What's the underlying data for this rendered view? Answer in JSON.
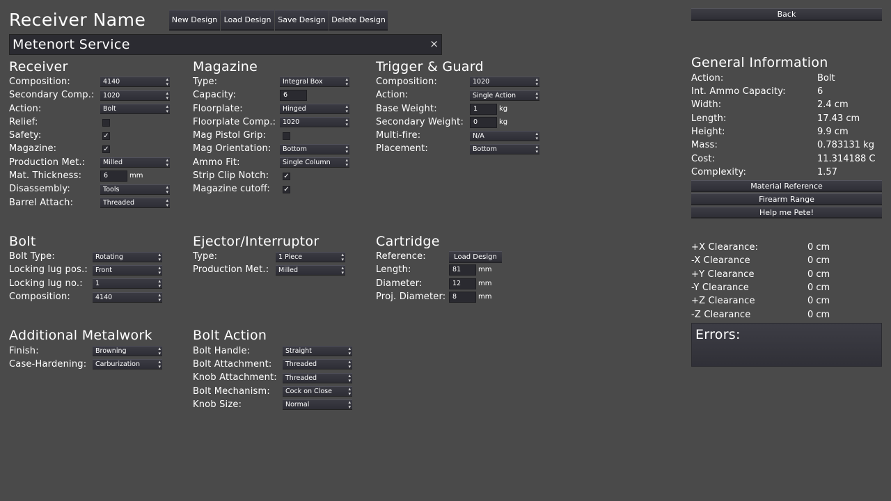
{
  "header": {
    "title": "Receiver Name",
    "buttons": [
      "New Design",
      "Load Design",
      "Save Design",
      "Delete Design"
    ],
    "name_value": "Metenort Service",
    "clear_glyph": "×",
    "back": "Back"
  },
  "receiver": {
    "heading": "Receiver",
    "labels": [
      "Composition:",
      "Secondary Comp.:",
      "Action:",
      "Relief:",
      "Safety:",
      "Magazine:",
      "Production Met.:",
      "Mat. Thickness:",
      "Disassembly:",
      "Barrel Attach:"
    ],
    "composition": "4140",
    "secondary": "1020",
    "action": "Bolt",
    "relief": false,
    "safety": true,
    "magazine": true,
    "production": "Milled",
    "thickness": "6",
    "thickness_unit": "mm",
    "disassembly": "Tools",
    "barrel_attach": "Threaded"
  },
  "magazine": {
    "heading": "Magazine",
    "labels": [
      "Type:",
      "Capacity:",
      "Floorplate:",
      "Floorplate Comp.:",
      "Mag Pistol Grip:",
      "Mag Orientation:",
      "Ammo Fit:",
      "Strip Clip Notch:",
      "Magazine cutoff:"
    ],
    "type": "Integral Box",
    "capacity": "6",
    "floorplate": "Hinged",
    "floorplate_comp": "1020",
    "pistol_grip": false,
    "orientation": "Bottom",
    "ammo_fit": "Single Column",
    "strip_clip": true,
    "cutoff": true
  },
  "trigger": {
    "heading": "Trigger & Guard",
    "labels": [
      "Composition:",
      "Action:",
      "Base Weight:",
      "Secondary Weight:",
      "Multi-fire:",
      "Placement:"
    ],
    "composition": "1020",
    "action": "Single Action",
    "base_weight": "1",
    "secondary_weight": "0",
    "unit": "kg",
    "multifire": "N/A",
    "placement": "Bottom"
  },
  "bolt": {
    "heading": "Bolt",
    "labels": [
      "Bolt Type:",
      "Locking lug pos.:",
      "Locking lug no.:",
      "Composition:"
    ],
    "type": "Rotating",
    "lug_pos": "Front",
    "lug_no": "1",
    "composition": "4140"
  },
  "ejector": {
    "heading": "Ejector/Interruptor",
    "labels": [
      "Type:",
      "Production Met.:"
    ],
    "type": "1 Piece",
    "production": "Milled"
  },
  "cartridge": {
    "heading": "Cartridge",
    "labels": [
      "Reference:",
      "Length:",
      "Diameter:",
      "Proj. Diameter:"
    ],
    "reference_button": "Load Design",
    "length": "81",
    "diameter": "12",
    "proj_diameter": "8",
    "unit": "mm"
  },
  "metalwork": {
    "heading": "Additional Metalwork",
    "labels": [
      "Finish:",
      "Case-Hardening:"
    ],
    "finish": "Browning",
    "case_hardening": "Carburization"
  },
  "bolt_action": {
    "heading": "Bolt Action",
    "labels": [
      "Bolt Handle:",
      "Bolt Attachment:",
      "Knob Attachment:",
      "Bolt Mechanism:",
      "Knob Size:"
    ],
    "handle": "Straight",
    "bolt_attachment": "Threaded",
    "knob_attachment": "Threaded",
    "mechanism": "Cock on Close",
    "knob_size": "Normal"
  },
  "info": {
    "heading": "General Information",
    "rows": [
      [
        "Action:",
        "Bolt"
      ],
      [
        "Int. Ammo Capacity:",
        "6"
      ],
      [
        "Width:",
        "2.4 cm"
      ],
      [
        "Length:",
        "17.43 cm"
      ],
      [
        "Height:",
        "9.9 cm"
      ],
      [
        "Mass:",
        "0.783131 kg"
      ],
      [
        "Cost:",
        "11.314188 C"
      ],
      [
        "Complexity:",
        "1.57"
      ]
    ],
    "buttons": [
      "Material Reference",
      "Firearm Range",
      "Help me Pete!"
    ]
  },
  "clearance": [
    [
      "+X Clearance:",
      "0 cm"
    ],
    [
      "-X Clearance",
      "0 cm"
    ],
    [
      "+Y Clearance",
      "0 cm"
    ],
    [
      "-Y Clearance",
      "0 cm"
    ],
    [
      "+Z Clearance",
      "0 cm"
    ],
    [
      "-Z Clearance",
      "0 cm"
    ]
  ],
  "errors": {
    "heading": "Errors:"
  }
}
